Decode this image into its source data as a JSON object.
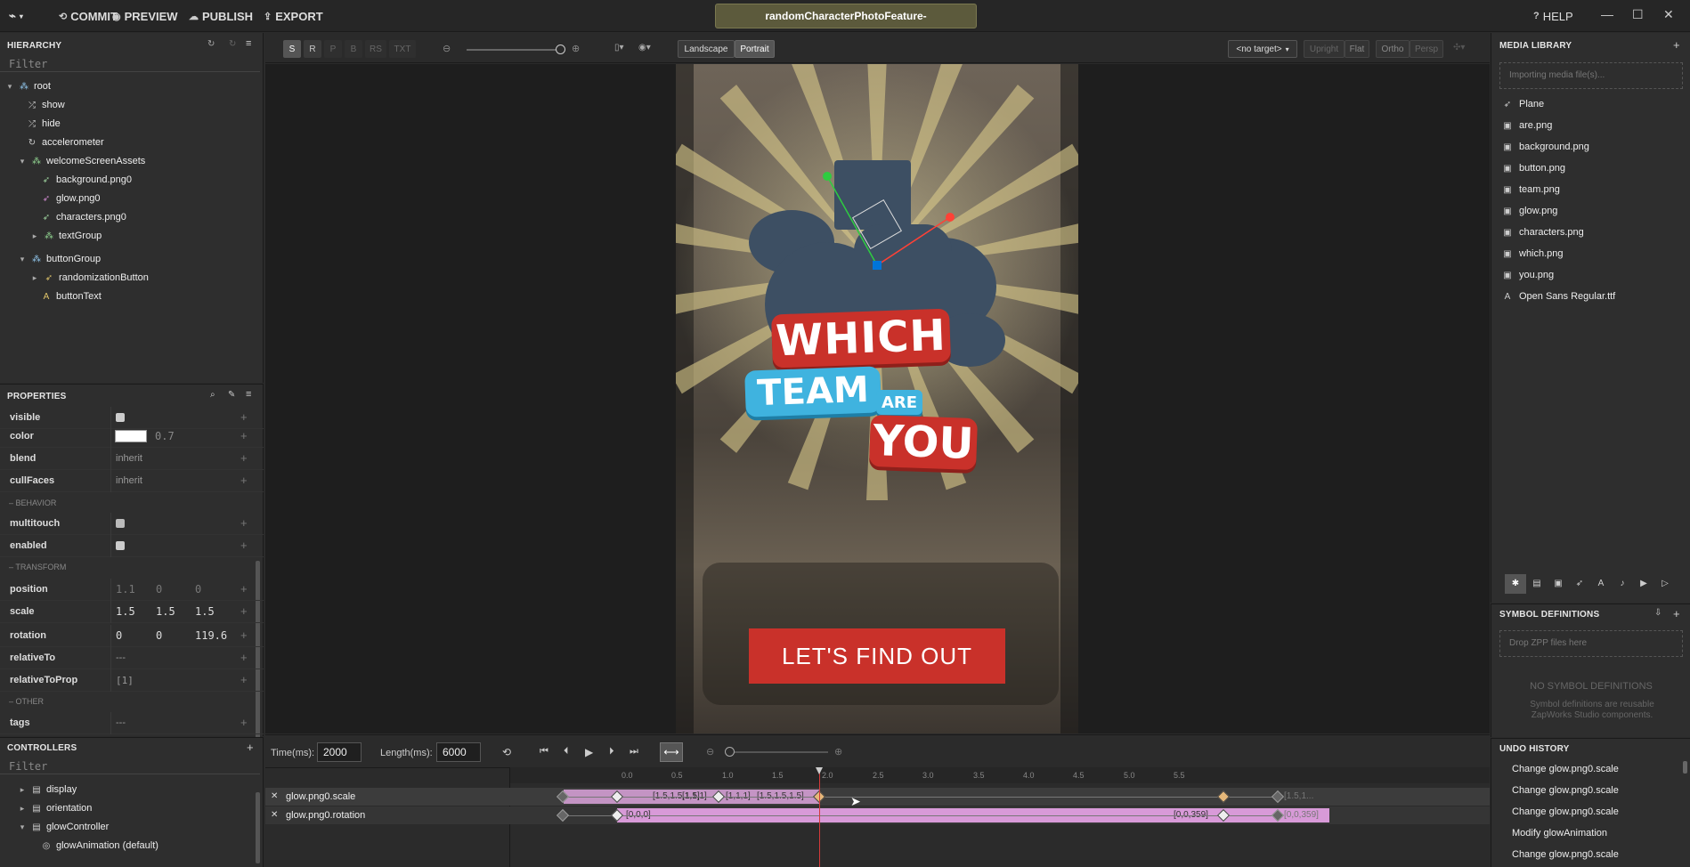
{
  "topbar": {
    "commit": "COMMIT",
    "preview": "PREVIEW",
    "publish": "PUBLISH",
    "export": "EXPORT",
    "doc_title": "randomCharacterPhotoFeature-",
    "help": "HELP"
  },
  "hierarchy": {
    "title": "HIERARCHY",
    "filter_placeholder": "Filter",
    "items": [
      {
        "label": "root",
        "icon": "group-icon"
      },
      {
        "label": "show",
        "icon": "shuffle-icon"
      },
      {
        "label": "hide",
        "icon": "shuffle-icon"
      },
      {
        "label": "accelerometer",
        "icon": "refresh-icon"
      },
      {
        "label": "welcomeScreenAssets",
        "icon": "group-icon"
      },
      {
        "label": "background.png0",
        "icon": "rocket-icon"
      },
      {
        "label": "glow.png0",
        "icon": "rocket-icon"
      },
      {
        "label": "characters.png0",
        "icon": "rocket-icon"
      },
      {
        "label": "textGroup",
        "icon": "group-icon"
      },
      {
        "label": "buttonGroup",
        "icon": "group-icon"
      },
      {
        "label": "randomizationButton",
        "icon": "rocket-icon"
      },
      {
        "label": "buttonText",
        "icon": "text-icon"
      }
    ]
  },
  "properties": {
    "title": "PROPERTIES",
    "visible": "visible",
    "color": "color",
    "color_value": "0.7",
    "blend": "blend",
    "blend_value": "inherit",
    "cullFaces": "cullFaces",
    "cullFaces_value": "inherit",
    "behavior_section": "BEHAVIOR",
    "multitouch": "multitouch",
    "enabled": "enabled",
    "transform_section": "TRANSFORM",
    "position": "position",
    "position_values": [
      "1.1",
      "0",
      "0"
    ],
    "scale": "scale",
    "scale_values": [
      "1.5",
      "1.5",
      "1.5"
    ],
    "rotation": "rotation",
    "rotation_values": [
      "0",
      "0",
      "119.6"
    ],
    "relativeTo": "relativeTo",
    "relativeTo_value": "---",
    "relativeToProp": "relativeToProp",
    "relativeToProp_value": "[1]",
    "other_section": "OTHER",
    "tags": "tags",
    "tags_value": "---"
  },
  "controllers": {
    "title": "CONTROLLERS",
    "filter_placeholder": "Filter",
    "items": [
      {
        "label": "display"
      },
      {
        "label": "orientation"
      },
      {
        "label": "glowController"
      },
      {
        "label": "glowAnimation (default)"
      }
    ]
  },
  "viewport": {
    "modes": [
      "S",
      "R",
      "P",
      "B",
      "RS",
      "TXT"
    ],
    "landscape": "Landscape",
    "portrait": "Portrait",
    "target": "<no target>",
    "upright": "Upright",
    "flat": "Flat",
    "ortho": "Ortho",
    "persp": "Persp",
    "title_line1": "WHICH",
    "title_line2": "TEAM",
    "title_are": "ARE",
    "title_line3": "YOU",
    "cta": "LET'S FIND OUT"
  },
  "timeline": {
    "time_label": "Time(ms):",
    "time_value": "2000",
    "length_label": "Length(ms):",
    "length_value": "6000",
    "ticks": [
      "0.0",
      "0.5",
      "1.0",
      "1.5",
      "2.0",
      "2.5",
      "3.0",
      "3.5",
      "4.0",
      "4.5",
      "5.0",
      "5.5"
    ],
    "tracks": [
      {
        "name": "glow.png0.scale",
        "labels": [
          "[1.5,1.5,1.5]",
          "[1,1,1]",
          "[1,1,1]",
          "[1.5,1.5,1.5]",
          "[1.5,1..."
        ]
      },
      {
        "name": "glow.png0.rotation",
        "labels": [
          "[0,0,0]",
          "[0,0,359]",
          "[0,0,359]"
        ]
      }
    ],
    "playhead_fraction": 0.333
  },
  "media": {
    "title": "MEDIA LIBRARY",
    "import_placeholder": "Importing media file(s)...",
    "items": [
      {
        "label": "Plane",
        "icon": "rocket-icon"
      },
      {
        "label": "are.png",
        "icon": "image-icon"
      },
      {
        "label": "background.png",
        "icon": "image-icon"
      },
      {
        "label": "button.png",
        "icon": "image-icon"
      },
      {
        "label": "team.png",
        "icon": "image-icon"
      },
      {
        "label": "glow.png",
        "icon": "image-icon"
      },
      {
        "label": "characters.png",
        "icon": "image-icon"
      },
      {
        "label": "which.png",
        "icon": "image-icon"
      },
      {
        "label": "you.png",
        "icon": "image-icon"
      },
      {
        "label": "Open Sans Regular.ttf",
        "icon": "font-icon"
      }
    ]
  },
  "symbols": {
    "title": "SYMBOL DEFINITIONS",
    "drop_placeholder": "Drop ZPP files here",
    "empty": "NO SYMBOL DEFINITIONS",
    "desc": "Symbol definitions are reusable ZapWorks Studio components."
  },
  "undo": {
    "title": "UNDO HISTORY",
    "items": [
      "Change glow.png0.scale",
      "Change glow.png0.scale",
      "Change glow.png0.scale",
      "Modify glowAnimation",
      "Change glow.png0.scale"
    ]
  },
  "colors": {
    "accent_red": "#c0392b",
    "track_pink": "#d89ad8",
    "title_bar": "#5c5a3c"
  }
}
